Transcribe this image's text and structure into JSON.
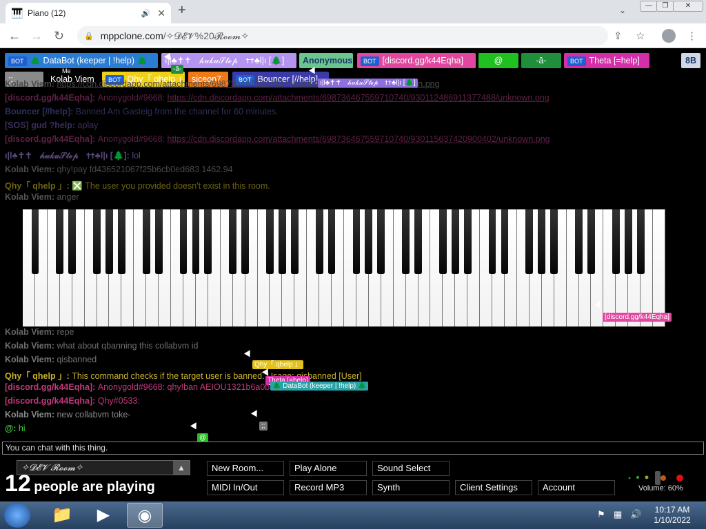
{
  "browser": {
    "tab_title": "Piano (12)",
    "url_host": "mppclone.com",
    "url_path": "/✧𝓓𝓔𝓥%20𝓡𝓸𝓸𝓶✧"
  },
  "participants": [
    {
      "label": "🌲 DataBot (keeper | !help) 🌲",
      "bot": true,
      "color": "#2a7cd4"
    },
    {
      "label": "ı|l♣✝✝ﾠ𝒽𝓊𝓀𝓊𝒮𝓉ℯ𝓅ﾠ✝✝♣l|ı [🌲]",
      "bot": false,
      "color": "#b494f0"
    },
    {
      "label": "Anonymous",
      "bot": false,
      "color": "#6cc48f"
    },
    {
      "label": "[discord.gg/k44Eqha]",
      "bot": true,
      "color": "#e2479f"
    },
    {
      "label": "@",
      "bot": false,
      "color": "#20c020"
    },
    {
      "label": "-ā-",
      "bot": false,
      "color": "#1f8f3b"
    },
    {
      "label": "Theta [=help]",
      "bot": true,
      "color": "#d32fa8"
    },
    {
      "label": "8B",
      "bot": false,
      "color": "#cfd8e8"
    },
    {
      "label": ";;",
      "bot": false,
      "color": "#8a8a8a"
    },
    {
      "label": "Kolab Viem",
      "bot": false,
      "color": "#000000"
    },
    {
      "label": "Qhy「 qhelp 」",
      "bot": true,
      "color": "#f0d11a"
    },
    {
      "label": "siceon7",
      "bot": false,
      "color": "#f07a18"
    },
    {
      "label": "Bouncer [//help]",
      "bot": true,
      "color": "#3a3aa8"
    }
  ],
  "bot_badge": "BOT",
  "me_label": "Me",
  "chat": [
    {
      "who": "Kolab Viem",
      "text": "https://cdn.discordapp.com/attachments/698736467559710740/930118859913265283/unknown.png",
      "color": "#4a4a4a",
      "link": true,
      "faded": true
    },
    {
      "who": "[discord.gg/k44Eqha]",
      "text": "Anonygold#9668: https://cdn.discordapp.com/attachments/698736467559710740/930112486911377488/unknown.png",
      "color": "#5e2144",
      "link": true,
      "faded": true
    },
    {
      "who": "Bouncer [//help]",
      "text": "Banned Am Gasteig from the channel for 60 minutes.",
      "color": "#2d2f5c",
      "link": false,
      "faded": true
    },
    {
      "who": "[SOS] gud ?help",
      "text": "aplay",
      "color": "#3b2e5e",
      "link": false,
      "faded": true
    },
    {
      "who": "[discord.gg/k44Eqha]",
      "text": "Anonygold#9668: https://cdn.discordapp.com/attachments/698736467559710740/930115637420900402/unknown.png",
      "color": "#5e2144",
      "link": true,
      "faded": true
    },
    {
      "who": "ı|l♣✝✝ﾠ𝒽𝓊𝓀𝓊𝒮𝓉ℯ𝓅ﾠ✝✝♣l|ı [🌲]",
      "text": "lol",
      "color": "#574877",
      "link": false,
      "faded": true
    },
    {
      "who": "Kolab Viem",
      "text": "qhy!pay fd436521067f25b6cb0ed683 1462.94",
      "color": "#4a4a4a",
      "link": false,
      "faded": true
    },
    {
      "who": "Qhy「 qhelp 」",
      "text": "❎ The user you provided doesn't exist in this room.",
      "color": "#6d6413",
      "link": false,
      "faded": false
    },
    {
      "who": "Kolab Viem",
      "text": "anger",
      "color": "#555",
      "link": false,
      "faded": true
    },
    {
      "who": "Kolab Viem",
      "text": "repe",
      "color": "#666",
      "link": false,
      "faded": true
    },
    {
      "who": "Kolab Viem",
      "text": "what about qbanning this collabvm id",
      "color": "#6e6e6e",
      "link": false,
      "faded": true
    },
    {
      "who": "Kolab Viem",
      "text": "qisbanned",
      "color": "#777",
      "link": false,
      "faded": true
    },
    {
      "who": "Qhy「 qhelp 」",
      "text": "This command checks if the target user is banned. Usage: qisbanned [User]",
      "color": "#c9b22c",
      "link": false,
      "faded": false
    },
    {
      "who": "[discord.gg/k44Eqha]",
      "text": "Anonygold#9668: qhy!ban AEIOU1321b6a0b8c47bf92d951d27",
      "color": "#c0397d",
      "link": false,
      "faded": false
    },
    {
      "who": "[discord.gg/k44Eqha]",
      "text": "Qhy#0533:",
      "color": "#c0397d",
      "link": false,
      "faded": false
    },
    {
      "who": "Kolab Viem",
      "text": "new collabvm toke-",
      "color": "#8a8a8a",
      "link": false,
      "faded": false
    },
    {
      "who": "@",
      "text": "hi",
      "color": "#3ed23e",
      "link": false,
      "faded": false
    }
  ],
  "chat_input_placeholder": "You can chat with this thing.",
  "room_name": "✧𝓓𝓔𝓥 𝓡𝓸𝓸𝓶✧",
  "playing_count": "12",
  "playing_text": "people are playing",
  "buttons": [
    "New Room...",
    "Play Alone",
    "Sound Select",
    "MIDI In/Out",
    "Record MP3",
    "Synth",
    "Client Settings",
    "Account"
  ],
  "volume_label": "Volume: 60%",
  "volume": 0.6,
  "cursors": [
    {
      "label": "Qhy「 qhelp 」",
      "color": "#e3c21c"
    },
    {
      "label": "Theta [=help]",
      "color": "#d32fa8"
    },
    {
      "label": "🌲 DataBot (keeper | !help) 🌲",
      "color": "#2aa3a8"
    },
    {
      "label": "[discord.gg/k44Eqha]",
      "color": "#e2479f"
    },
    {
      "label": "ı|l♣✝✝ﾠ𝒽𝓊𝓀𝓊𝒮𝓉ℯ𝓅ﾠ✝✝♣l|ı [🌲]",
      "color": "#8f6fe0"
    },
    {
      "label": "-ā-",
      "color": "#1f8f3b"
    },
    {
      "label": "@",
      "color": "#20c020"
    },
    {
      "label": ";;",
      "color": "#777"
    }
  ],
  "clock": {
    "time": "10:17 AM",
    "date": "1/10/2022"
  }
}
